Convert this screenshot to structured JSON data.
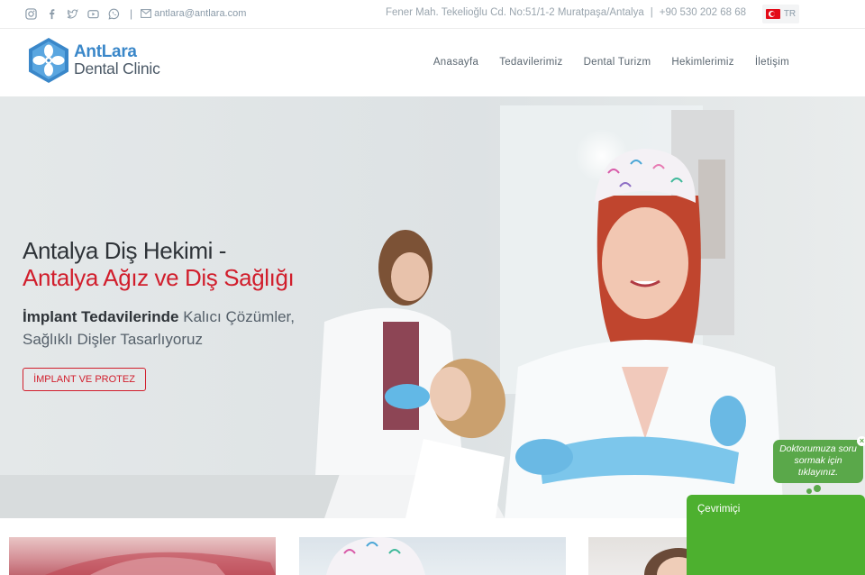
{
  "topbar": {
    "social": [
      "instagram-icon",
      "facebook-icon",
      "twitter-icon",
      "youtube-icon",
      "whatsapp-icon"
    ],
    "separator": "|",
    "email": "antlara@antlara.com",
    "address": "Fener Mah. Tekelioğlu Cd. No:51/1-2 Muratpaşa/Antalya",
    "divider": "|",
    "phone": "+90 530 202 68 68",
    "language": "TR"
  },
  "brand": {
    "name": "AntLara",
    "tagline": "Dental Clinic",
    "color": "#3a87c9"
  },
  "nav": {
    "items": [
      "Anasayfa",
      "Tedavilerimiz",
      "Dental Turizm",
      "Hekimlerimiz",
      "İletişim"
    ]
  },
  "hero": {
    "title_line1": "Antalya Diş Hekimi -",
    "title_line2": "Antalya Ağız ve Diş Sağlığı",
    "subtitle_bold": "İmplant Tedavilerinde",
    "subtitle_rest": " Kalıcı Çözümler, Sağlıklı Dişler Tasarlıyoruz",
    "button_label": "İMPLANT VE PROTEZ",
    "accent": "#d11e2c"
  },
  "chat": {
    "bubble_text": "Doktorumuza soru sormak için tıklayınız.",
    "close_label": "×",
    "status": "Çevrimiçi",
    "color": "#4db02f"
  }
}
